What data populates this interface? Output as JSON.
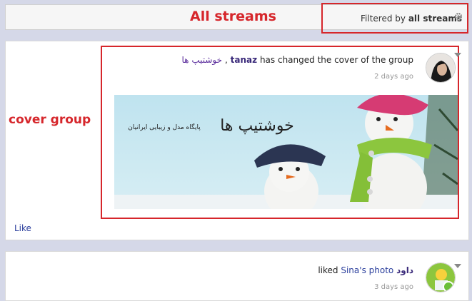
{
  "annotations": {
    "all_streams": "All streams",
    "cover_group": "cover group"
  },
  "filter": {
    "prefix": "Filtered by",
    "value": "all streams",
    "icon": "gear-icon"
  },
  "posts": [
    {
      "user": "tanaz",
      "action": "has changed the cover of the group",
      "group": "خوشتیپ ها",
      "time": "2 days ago",
      "banner_caption": "خوشتیپ ها",
      "banner_subtitle": "پایگاه مدل و زیبایی ایرانیان",
      "like": "Like"
    },
    {
      "user": "داود",
      "action": "liked",
      "target_owner": "Sina's",
      "target": "photo",
      "time": "3 days ago"
    }
  ],
  "colors": {
    "annotation_red": "#d6262b",
    "link_blue": "#2a3e9c",
    "page_bg": "#d5d8e8"
  }
}
